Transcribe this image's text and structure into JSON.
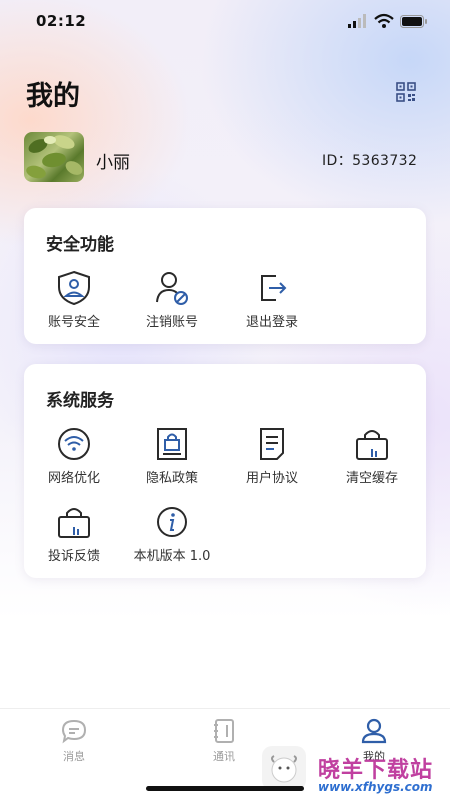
{
  "status_bar": {
    "time": "02:12"
  },
  "header": {
    "title": "我的",
    "qr_icon": "qr-code-icon"
  },
  "profile": {
    "name": "小丽",
    "id_text": "ID：5363732"
  },
  "security": {
    "title": "安全功能",
    "items": [
      {
        "label": "账号安全",
        "icon": "shield-user-icon"
      },
      {
        "label": "注销账号",
        "icon": "user-cancel-icon"
      },
      {
        "label": "退出登录",
        "icon": "logout-icon"
      }
    ]
  },
  "services": {
    "title": "系统服务",
    "items": [
      {
        "label": "网络优化",
        "icon": "wifi-icon"
      },
      {
        "label": "隐私政策",
        "icon": "privacy-lock-icon"
      },
      {
        "label": "用户协议",
        "icon": "document-icon"
      },
      {
        "label": "清空缓存",
        "icon": "bag-icon"
      },
      {
        "label": "投诉反馈",
        "icon": "feedback-bag-icon"
      },
      {
        "label": "本机版本 1.0",
        "icon": "info-icon"
      }
    ]
  },
  "tabbar": {
    "tabs": [
      {
        "label": "消息",
        "icon": "message-icon",
        "active": false
      },
      {
        "label": "通讯",
        "icon": "contacts-book-icon",
        "active": false
      },
      {
        "label": "我的",
        "icon": "profile-icon",
        "active": true
      }
    ]
  },
  "watermark": {
    "text": "晓羊下载站",
    "url": "www.xfhygs.com"
  },
  "colors": {
    "accent": "#2f5ea8",
    "background": "#f3f1f9",
    "card": "#ffffff",
    "text": "#111111"
  }
}
